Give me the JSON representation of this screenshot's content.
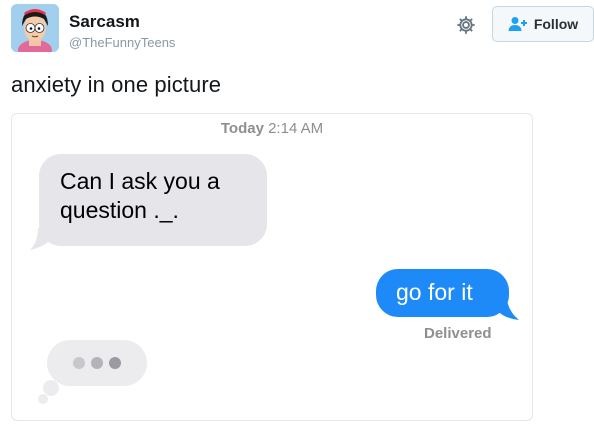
{
  "account": {
    "name": "Sarcasm",
    "handle": "@TheFunnyTeens",
    "avatar_icon": "cartoon-avatar-icon"
  },
  "actions": {
    "settings_icon": "gear-icon",
    "follow_label": "Follow",
    "follow_icon": "add-user-icon"
  },
  "tweet": {
    "text": "anxiety in one picture"
  },
  "conversation": {
    "day": "Today",
    "time": "2:14 AM",
    "incoming_line1": "Can I ask you a",
    "incoming_line2": "question ._.",
    "outgoing": "go for it",
    "status": "Delivered",
    "typing_icon": "typing-indicator-icon"
  },
  "colors": {
    "outgoing_bubble": "#1d8af7",
    "incoming_bubble": "#e5e5ea",
    "muted_text": "#8e8e93"
  }
}
